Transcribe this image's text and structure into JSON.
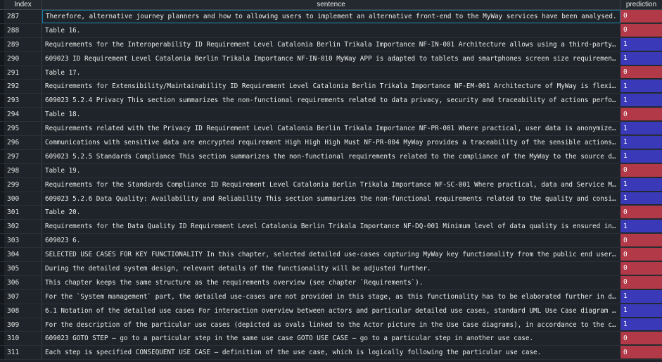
{
  "columns": {
    "index": "Index",
    "sentence": "sentence",
    "prediction": "prediction"
  },
  "colors": {
    "pred_0": "#b23a48",
    "pred_1": "#3a3ab8"
  },
  "rows": [
    {
      "index": "287",
      "sentence": "Therefore, alternative journey planners and how to allowing users to implement an alternative front-end to the MyWay services have been analysed.",
      "prediction": "0"
    },
    {
      "index": "288",
      "sentence": "Table 16.",
      "prediction": "0"
    },
    {
      "index": "289",
      "sentence": "Requirements for the Interoperability ID Requirement Level Catalonia Berlin Trikala Importance NF-IN-001 Architecture allows using a third-party journey pla…",
      "prediction": "1"
    },
    {
      "index": "290",
      "sentence": "609023 ID Requirement Level Catalonia Berlin Trikala Importance NF-IN-010 MyWay APP is adapted to tablets and smartphones screen size requirement High Low L…",
      "prediction": "1"
    },
    {
      "index": "291",
      "sentence": "Table 17.",
      "prediction": "0"
    },
    {
      "index": "292",
      "sentence": "Requirements for Extensibility/Maintainability ID Requirement Level Catalonia Berlin Trikala Importance NF-EM-001 Architecture of MyWay is flexible enough t…",
      "prediction": "1"
    },
    {
      "index": "293",
      "sentence": "609023 5.2.4 Privacy This section summarizes the non-functional requirements related to data privacy, security and traceability of actions performed by the …",
      "prediction": "1"
    },
    {
      "index": "294",
      "sentence": "Table 18.",
      "prediction": "0"
    },
    {
      "index": "295",
      "sentence": "Requirements related with the Privacy ID Requirement Level Catalonia Berlin Trikala Importance NF-PR-001 Where practical, user data is anonymized requiremen…",
      "prediction": "1"
    },
    {
      "index": "296",
      "sentence": "Communications with sensitive data are encrypted requirement High High High Must NF-PR-004 MyWay provides a traceability of the sensible actions performed b…",
      "prediction": "1"
    },
    {
      "index": "297",
      "sentence": "609023 5.2.5 Standards Compliance This section summarizes the non-functional requirements related to the compliance of the MyWay to the source data standard…",
      "prediction": "1"
    },
    {
      "index": "298",
      "sentence": "Table 19.",
      "prediction": "0"
    },
    {
      "index": "299",
      "sentence": "Requirements for the Standards Compliance ID Requirement Level Catalonia Berlin Trikala Importance NF-SC-001 Where practical, data and Service Model should …",
      "prediction": "1"
    },
    {
      "index": "300",
      "sentence": "609023 5.2.6 Data Quality: Availability and Reliability This section summarizes the non-functional requirements related to the quality and consistency of da…",
      "prediction": "1"
    },
    {
      "index": "301",
      "sentence": "Table 20.",
      "prediction": "0"
    },
    {
      "index": "302",
      "sentence": "Requirements for the Data Quality ID Requirement Level Catalonia Berlin Trikala Importance NF-DQ-001 Minimum level of data quality is ensured in order to ma…",
      "prediction": "1"
    },
    {
      "index": "303",
      "sentence": "609023 6.",
      "prediction": "0"
    },
    {
      "index": "304",
      "sentence": "SELECTED USE CASES FOR KEY FUNCTIONALITY In this chapter, selected detailed use-cases capturing MyWay key functionality from the public end user’s point of …",
      "prediction": "0"
    },
    {
      "index": "305",
      "sentence": "During the detailed system design, relevant details of the functionality will be adjusted further.",
      "prediction": "0"
    },
    {
      "index": "306",
      "sentence": "This chapter keeps the same structure as the requirements overview (see chapter `Requirements`).",
      "prediction": "0"
    },
    {
      "index": "307",
      "sentence": "For the `System management` part, the detailed use-cases are not provided in this stage, as this functionality has to be elaborated further in detail during…",
      "prediction": "1"
    },
    {
      "index": "308",
      "sentence": "6.1 Notation of the detailed use cases For interaction overview between actors and particular detailed use cases, standard UML Use Case diagram is being use…",
      "prediction": "1"
    },
    {
      "index": "309",
      "sentence": "For the description of the particular use cases (depicted as ovals linked to the Actor picture in the Use Case diagrams), in accordance to the common softwa…",
      "prediction": "1"
    },
    {
      "index": "310",
      "sentence": "609023  GOTO STEP – go to a particular step in the same use case  GOTO USE CASE – go to a particular step in another use case.",
      "prediction": "0"
    },
    {
      "index": "311",
      "sentence": "Each step is specified  CONSEQUENT USE CASE – definition of the use case, which is logically following the particular use case.",
      "prediction": "0"
    }
  ]
}
